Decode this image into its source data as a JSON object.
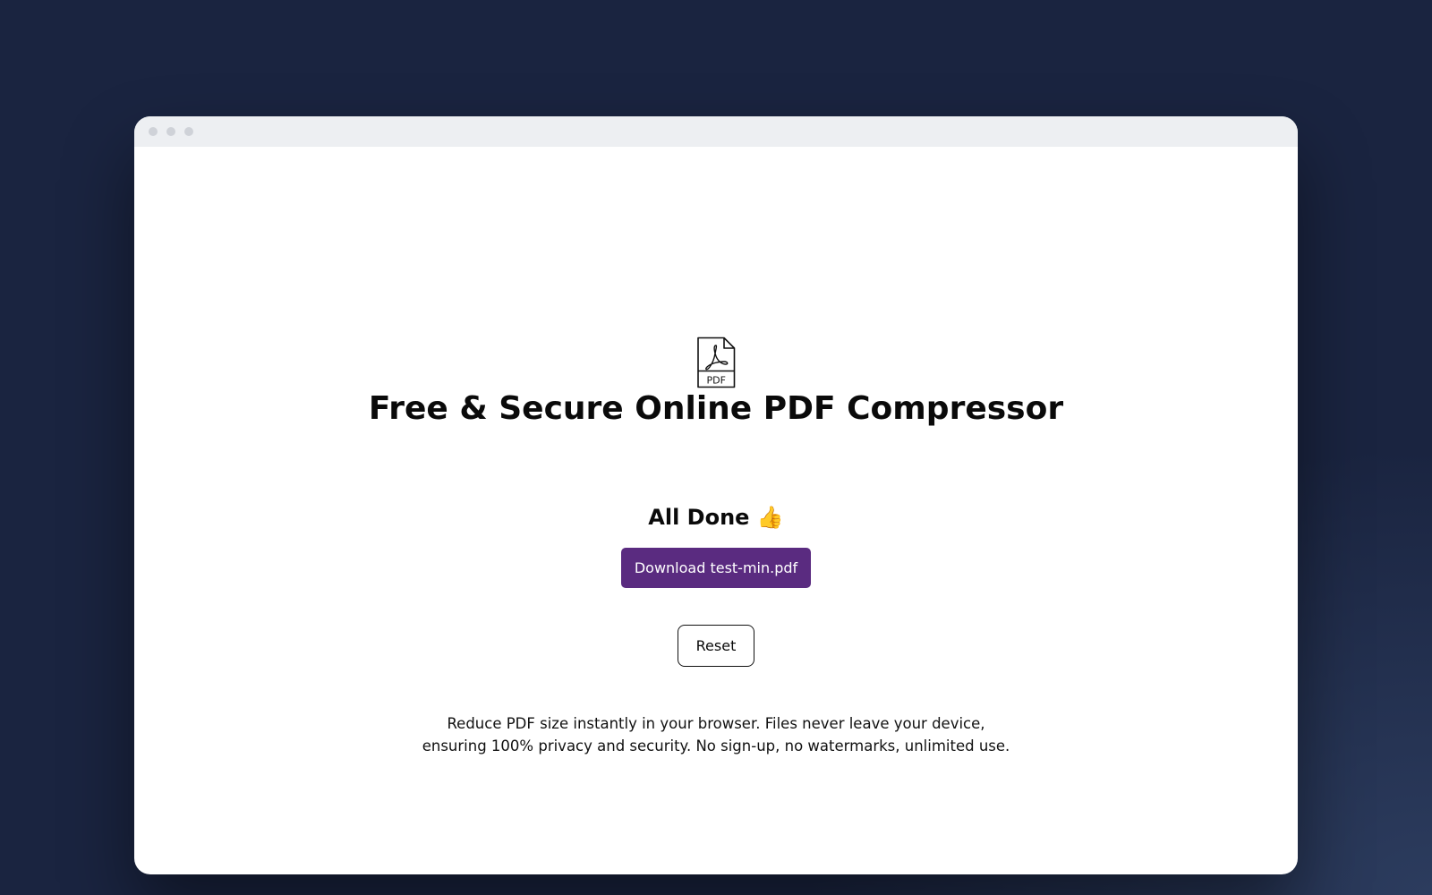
{
  "window": {
    "controls": [
      "close",
      "minimize",
      "maximize"
    ]
  },
  "main": {
    "icon": "pdf-file-icon",
    "icon_label": "PDF",
    "title": "Free & Secure Online PDF Compressor",
    "status": "All Done 👍",
    "download_label": "Download test-min.pdf",
    "reset_label": "Reset",
    "description_line1": "Reduce PDF size instantly in your browser. Files never leave your device,",
    "description_line2": "ensuring 100% privacy and security. No sign-up, no watermarks, unlimited use."
  },
  "colors": {
    "background": "#1a2440",
    "accent": "#5a2b80",
    "titlebar": "#edeff2"
  }
}
